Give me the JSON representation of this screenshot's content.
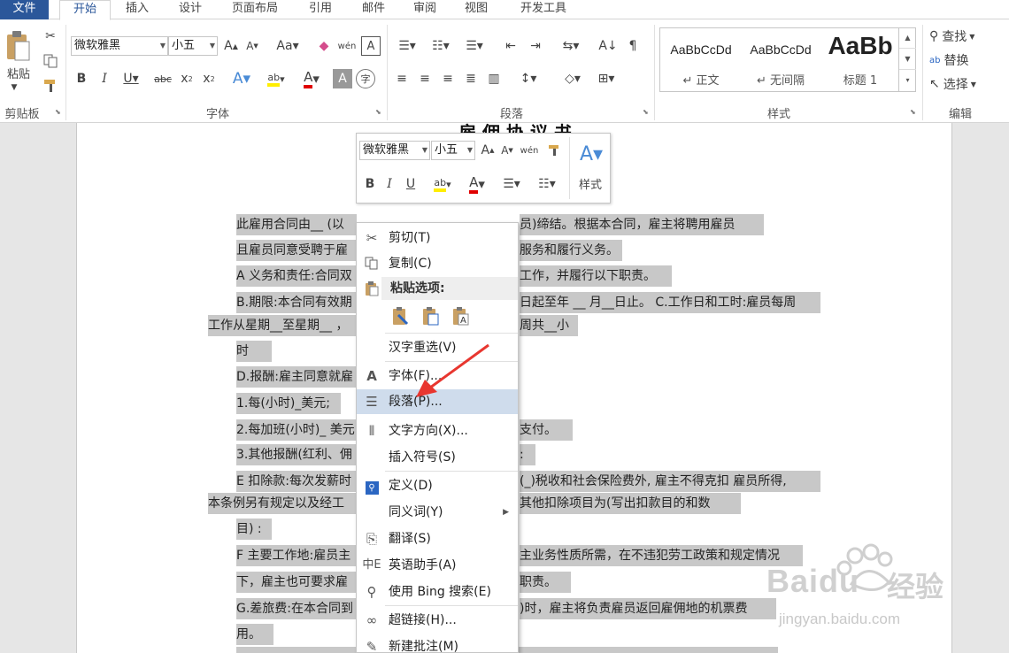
{
  "tabs": {
    "file": "文件",
    "home": "开始",
    "insert": "插入",
    "design": "设计",
    "layout": "页面布局",
    "references": "引用",
    "mailings": "邮件",
    "review": "审阅",
    "view": "视图",
    "developer": "开发工具"
  },
  "ribbon": {
    "clipboard": {
      "label": "剪贴板",
      "paste": "粘贴"
    },
    "font": {
      "label": "字体",
      "name": "微软雅黑",
      "size": "小五"
    },
    "paragraph": {
      "label": "段落"
    },
    "styles": {
      "label": "样式",
      "items": [
        {
          "sample": "AaBbCcDd",
          "name": "↵ 正文"
        },
        {
          "sample": "AaBbCcDd",
          "name": "↵ 无间隔"
        },
        {
          "sample": "AaBb",
          "name": "标题 1"
        }
      ]
    },
    "editing": {
      "label": "编辑",
      "find": "查找",
      "replace": "替换",
      "select": "选择"
    }
  },
  "mini_toolbar": {
    "font": "微软雅黑",
    "size": "小五",
    "styles": "样式"
  },
  "context_menu": {
    "cut": "剪切(T)",
    "copy": "复制(C)",
    "paste_options": "粘贴选项:",
    "reconvert": "汉字重选(V)",
    "font": "字体(F)...",
    "paragraph": "段落(P)...",
    "text_direction": "文字方向(X)...",
    "insert_symbol": "插入符号(S)",
    "define": "定义(D)",
    "synonyms": "同义词(Y)",
    "translate": "翻译(S)",
    "english_assistant": "英语助手(A)",
    "bing_search": "使用 Bing 搜索(E)",
    "hyperlink": "超链接(H)...",
    "new_comment": "新建批注(M)"
  },
  "document": {
    "lines": [
      {
        "left": "此雇用合同由__ (以",
        "right": "员)缔结。根据本合同，雇主将聘用雇员"
      },
      {
        "left": "且雇员同意受聘于雇",
        "right": "服务和履行义务。"
      },
      {
        "left": "A 义务和责任:合同双",
        "right": "工作，并履行以下职责。"
      },
      {
        "left": "B.期限:本合同有效期",
        "right": "日起至年 __ 月__日止。  C.工作日和工时:雇员每周"
      },
      {
        "left": "工作从星期__至星期__ ，",
        "right": "周共__小"
      },
      {
        "left": "时",
        "right": ""
      },
      {
        "left": "D.报酬:雇主同意就雇",
        "right": ""
      },
      {
        "left": "1.每(小时)_美元;",
        "right": ""
      },
      {
        "left": "2.每加班(小时)_ 美元",
        "right": "支付。"
      },
      {
        "left": "3.其他报酬(红利、佣",
        "right": ":"
      },
      {
        "left": "E 扣除款:每次发薪时",
        "right": "(_)税收和社会保险费外, 雇主不得克扣  雇员所得,"
      },
      {
        "left": "本条例另有规定以及经工",
        "right": "其他扣除项目为(写出扣款目的和数"
      },
      {
        "left": "目) :",
        "right": ""
      },
      {
        "left": "F 主要工作地:雇员主",
        "right": "主业务性质所需，在不违犯劳工政策和规定情况"
      },
      {
        "left": "下，雇主也可要求雇",
        "right": "职责。"
      },
      {
        "left": "G.差旅费:在本合同到",
        "right": ")时，雇主将负责雇员返回雇佣地的机票费"
      },
      {
        "left": "用。",
        "right": ""
      }
    ]
  },
  "watermark": {
    "brand": "Baidu",
    "cn": "经验",
    "url": "jingyan.baidu.com"
  },
  "colors": {
    "file_tab": "#2b579a",
    "selection": "#c8c8c8",
    "highlight": "#cfdcec",
    "arrow": "#e8362f"
  }
}
